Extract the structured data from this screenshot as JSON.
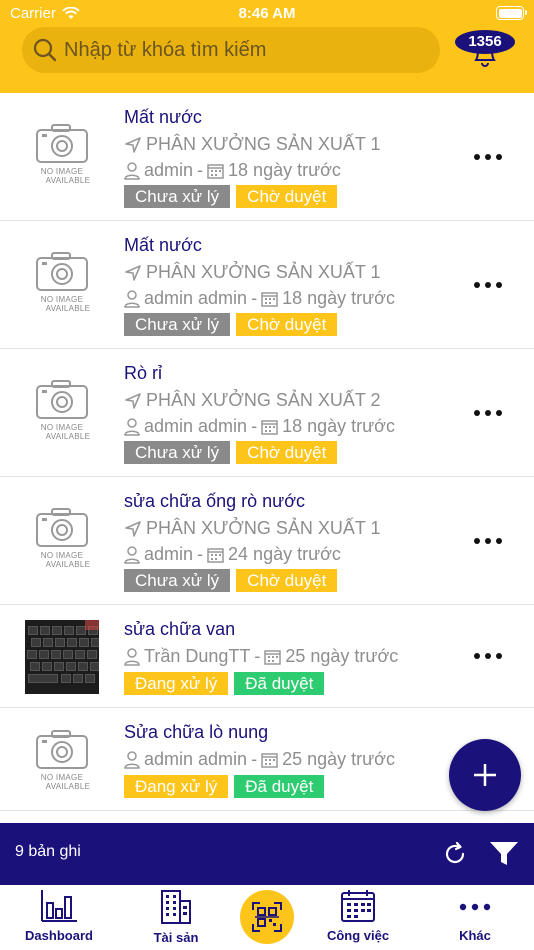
{
  "status_bar": {
    "carrier": "Carrier",
    "time": "8:46 AM"
  },
  "search": {
    "placeholder": "Nhập từ khóa tìm kiếm"
  },
  "notifications": {
    "count": "1356"
  },
  "no_image": {
    "line1": "NO IMAGE",
    "line2": "AVAILABLE"
  },
  "items": [
    {
      "title": "Mất nước",
      "location": "PHÂN XƯỞNG SẢN XUẤT 1",
      "user": "admin",
      "time": "18 ngày trước",
      "status": "Chưa xử lý",
      "approval": "Chờ duyệt",
      "image": "none"
    },
    {
      "title": "Mất nước",
      "location": "PHÂN XƯỞNG SẢN XUẤT 1",
      "user": "admin admin",
      "time": "18 ngày trước",
      "status": "Chưa xử lý",
      "approval": "Chờ duyệt",
      "image": "none"
    },
    {
      "title": "Rò rỉ",
      "location": "PHÂN XƯỞNG SẢN XUẤT 2",
      "user": "admin admin",
      "time": "18 ngày trước",
      "status": "Chưa xử lý",
      "approval": "Chờ duyệt",
      "image": "none"
    },
    {
      "title": "sửa chữa ống rò nước",
      "location": "PHÂN XƯỞNG SẢN XUẤT 1",
      "user": "admin",
      "time": "24 ngày trước",
      "status": "Chưa xử lý",
      "approval": "Chờ duyệt",
      "image": "none"
    },
    {
      "title": "sửa chữa van",
      "location": "",
      "user": "Trần DungTT",
      "time": "25 ngày trước",
      "status": "Đang xử lý",
      "approval": "Đã duyệt",
      "image": "keyboard-photo"
    },
    {
      "title": "Sửa chữa lò nung",
      "location": "",
      "user": "admin admin",
      "time": "25 ngày trước",
      "status": "Đang xử lý",
      "approval": "Đã duyệt",
      "image": "none"
    }
  ],
  "separator": "-",
  "record_bar": {
    "count_label": "9 bản ghi"
  },
  "tabs": [
    {
      "label": "Dashboard",
      "icon": "bar-chart-icon"
    },
    {
      "label": "Tài sản",
      "icon": "building-icon"
    },
    {
      "label": "",
      "icon": "qr-scan-icon"
    },
    {
      "label": "Công việc",
      "icon": "calendar-icon"
    },
    {
      "label": "Khác",
      "icon": "more-dots-icon"
    }
  ],
  "colors": {
    "header": "#FDC41A",
    "primary": "#1A127A",
    "gray_tag": "#8A8A8A",
    "green_tag": "#2ECC71"
  }
}
